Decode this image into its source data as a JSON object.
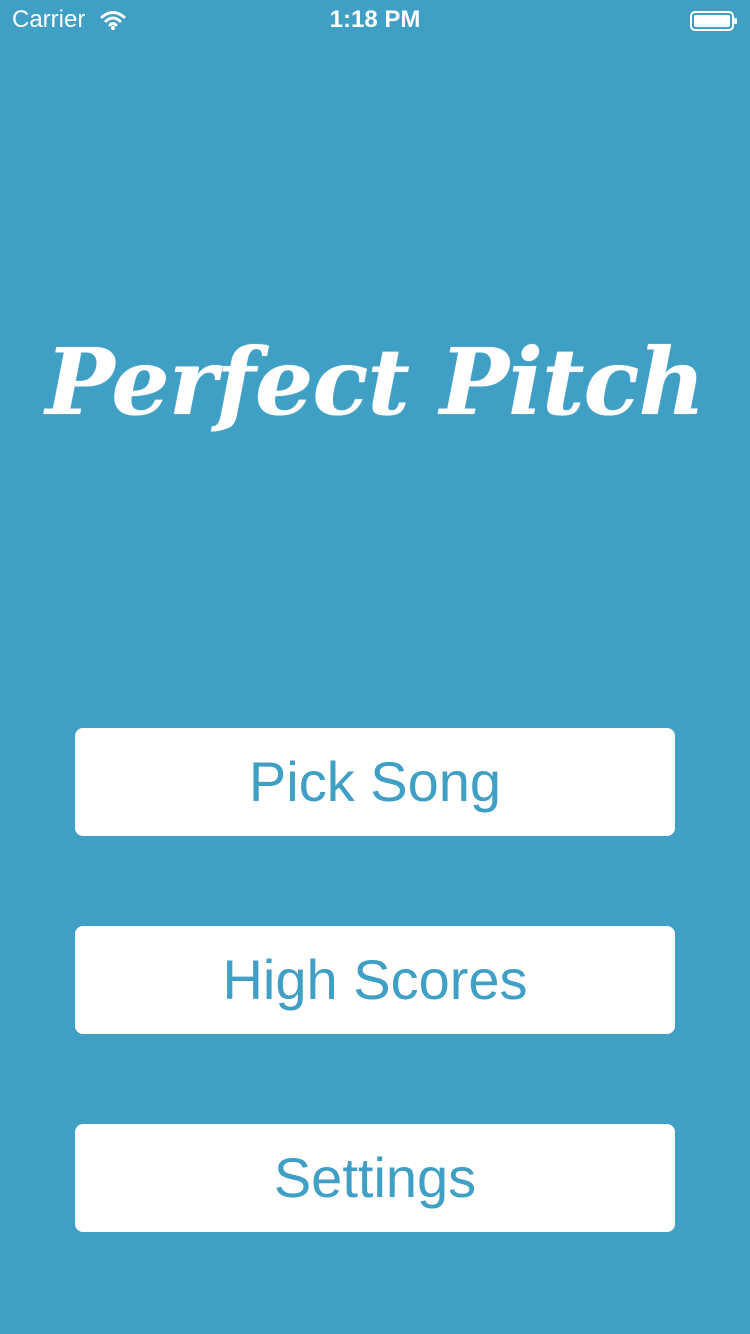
{
  "status_bar": {
    "carrier": "Carrier",
    "time": "1:18 PM",
    "wifi_icon": "wifi-icon",
    "battery_icon": "battery-icon"
  },
  "app": {
    "title": "Perfect Pitch"
  },
  "menu": {
    "pick_song": "Pick Song",
    "high_scores": "High Scores",
    "settings": "Settings"
  },
  "colors": {
    "background": "#3f9fc4",
    "button_background": "#ffffff",
    "button_text": "#3f9fc4",
    "title_text": "#ffffff"
  }
}
